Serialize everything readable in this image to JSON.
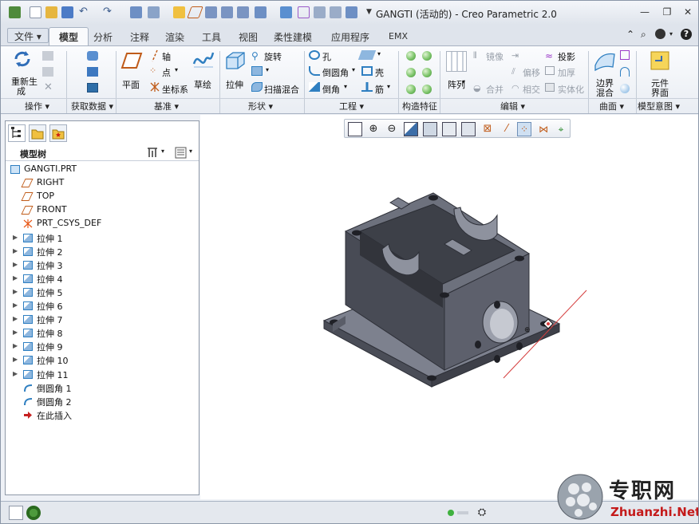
{
  "window": {
    "title": "GANGTI (活动的) - Creo Parametric 2.0",
    "controls": [
      "—",
      "❐",
      "✕"
    ]
  },
  "tabs": {
    "file": "文件",
    "items": [
      "模型",
      "分析",
      "注释",
      "渲染",
      "工具",
      "视图",
      "柔性建模",
      "应用程序",
      "EMX"
    ]
  },
  "ribbon": {
    "ops": {
      "regen_l1": "重新生",
      "regen_l2": "成"
    },
    "datum": {
      "plane": "平面",
      "axis": "轴",
      "point": "点",
      "csys": "坐标系",
      "sketch": "草绘"
    },
    "shapes": {
      "extrude": "拉伸",
      "revolve": "旋转",
      "sweep_blend": "扫描混合"
    },
    "engineering": {
      "hole": "孔",
      "round": "倒圆角",
      "chamfer": "倒角",
      "shell": "壳",
      "rib": "筋"
    },
    "editing": {
      "pattern": "阵列",
      "mirror": "镜像",
      "merge": "合并",
      "offset": "偏移",
      "intersect": "相交",
      "project": "投影",
      "thicken": "加厚",
      "solidify": "实体化"
    },
    "surfaces": {
      "boundary_l1": "边界",
      "boundary_l2": "混合"
    },
    "intent": {
      "comp_l1": "元件",
      "comp_l2": "界面"
    },
    "groups": {
      "operations": "操作 ▾",
      "get_data": "获取数据 ▾",
      "datum": "基准 ▾",
      "shapes": "形状 ▾",
      "engineering": "工程 ▾",
      "construction": "构造特征",
      "editing": "编辑 ▾",
      "surfaces": "曲面 ▾",
      "intent": "模型意图 ▾"
    }
  },
  "model_tree": {
    "title": "模型树",
    "items": [
      {
        "label": "GANGTI.PRT",
        "type": "part",
        "expandable": false
      },
      {
        "label": "RIGHT",
        "type": "plane",
        "expandable": false
      },
      {
        "label": "TOP",
        "type": "plane",
        "expandable": false
      },
      {
        "label": "FRONT",
        "type": "plane",
        "expandable": false
      },
      {
        "label": "PRT_CSYS_DEF",
        "type": "csys",
        "expandable": false
      },
      {
        "label": "拉伸 1",
        "type": "extrude",
        "expandable": true
      },
      {
        "label": "拉伸 2",
        "type": "extrude",
        "expandable": true
      },
      {
        "label": "拉伸 3",
        "type": "extrude",
        "expandable": true
      },
      {
        "label": "拉伸 4",
        "type": "extrude",
        "expandable": true
      },
      {
        "label": "拉伸 5",
        "type": "extrude",
        "expandable": true
      },
      {
        "label": "拉伸 6",
        "type": "extrude",
        "expandable": true
      },
      {
        "label": "拉伸 7",
        "type": "extrude",
        "expandable": true
      },
      {
        "label": "拉伸 8",
        "type": "extrude",
        "expandable": true
      },
      {
        "label": "拉伸 9",
        "type": "extrude",
        "expandable": true
      },
      {
        "label": "拉伸 10",
        "type": "extrude",
        "expandable": true
      },
      {
        "label": "拉伸 11",
        "type": "extrude",
        "expandable": true
      },
      {
        "label": "倒圆角 1",
        "type": "round",
        "expandable": false
      },
      {
        "label": "倒圆角 2",
        "type": "round",
        "expandable": false
      },
      {
        "label": "在此插入",
        "type": "insert",
        "expandable": false
      }
    ]
  },
  "watermark": {
    "cn": "专职网",
    "en": "Zhuanzhi.Net"
  },
  "colors": {
    "accent": "#2f7fc1",
    "model": "#5a5d68",
    "insert_arrow": "#c62020",
    "csys": "#e85a1a"
  }
}
